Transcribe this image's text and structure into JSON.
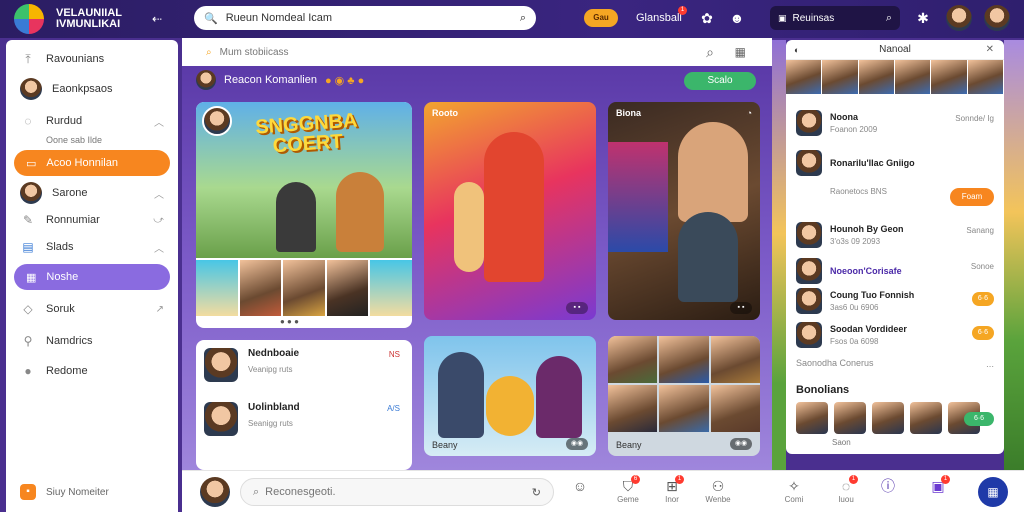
{
  "app": {
    "title_line1": "VELAUNIIAL",
    "title_line2": "IVMUNLIKAI",
    "brand_colors": {
      "purple": "#3a2580",
      "orange": "#f7861f",
      "green": "#3bb66b"
    }
  },
  "topbar": {
    "search_placeholder": "Rueun Nomdeal Icam",
    "coin_label": "Gau",
    "user_label": "Glansball",
    "notif_count": "1",
    "search2_placeholder": "Reuinsas"
  },
  "sidebar": {
    "items": [
      {
        "label": "Ravounians",
        "icon": "compass-icon"
      },
      {
        "label": "Eaonkpsaos",
        "icon": "avatar-icon"
      },
      {
        "label": "Rurdud",
        "sub": "Oone sab Ilde",
        "icon": "chat-icon"
      },
      {
        "label": "Acoo Honnilan",
        "icon": "video-icon"
      },
      {
        "label": "Sarone",
        "icon": "avatar-icon"
      },
      {
        "label": "Ronnumiar",
        "icon": "mic-icon"
      },
      {
        "label": "Slads",
        "icon": "slides-icon"
      },
      {
        "label": "Noshe",
        "icon": "grid-icon"
      },
      {
        "label": "Soruk",
        "icon": "share-icon"
      },
      {
        "label": "Namdrics",
        "icon": "wrench-icon"
      },
      {
        "label": "Redome",
        "icon": "circle-icon"
      }
    ],
    "footer": "Siuy Nomeiter"
  },
  "main": {
    "header": "Mum stobiicass",
    "channel": "Reacon Komanlien",
    "live_button": "Scalo",
    "cards": {
      "hero_title_line1": "SNGGNBA",
      "hero_title_line2": "COERT",
      "dance_caption": "Rooto",
      "arcade_caption": "Biona",
      "bottom1_label": "Beany",
      "bottom2_label": "Beany"
    },
    "chat": [
      {
        "name": "Nednboaie",
        "sub": "Veanipg ruts",
        "tag": "NS"
      },
      {
        "name": "Uolinbland",
        "sub": "Seanigg ruts",
        "tag": "A/S"
      }
    ]
  },
  "bottombar": {
    "input_placeholder": "Reconesgeoti.",
    "nav": [
      {
        "label": "Geme",
        "icon": "bag-icon",
        "badge": "6"
      },
      {
        "label": "Inor",
        "icon": "cart-icon",
        "badge": "1"
      },
      {
        "label": "Wenbe",
        "icon": "person-icon"
      },
      {
        "label": "Comi",
        "icon": "sparkle-icon"
      },
      {
        "label": "Iuou",
        "icon": "globe-icon",
        "badge": "1"
      },
      {
        "label": "",
        "icon": "info-icon"
      },
      {
        "label": "",
        "icon": "controller-icon",
        "badge": "1"
      }
    ]
  },
  "rpanel": {
    "title": "Nanoal",
    "rows": [
      {
        "name": "Noona",
        "sub": "Foanon 2009",
        "meta": "Sonnde/ Ig"
      },
      {
        "name": "Ronarilu'llac Gniigo",
        "sub": "Raonetocs BNS",
        "meta": "",
        "button": "Foam"
      },
      {
        "name": "Hounoh By Geon",
        "sub": "3'o3s 09 2093",
        "meta": "Sanang"
      },
      {
        "name": "Noeoon'Corisafe",
        "sub": "",
        "meta": "Sonoe"
      },
      {
        "name": "Coung Tuo Fonnish",
        "sub": "3as6 0u 6906",
        "badge": "6·6"
      },
      {
        "name": "Soodan Vordideer",
        "sub": "Fsos 0a 6098",
        "badge": "6·6"
      }
    ],
    "more_label": "Saonodha Conerus",
    "section_title": "Bonolians",
    "section_foot": "Saon",
    "green_tag": "6·6"
  }
}
